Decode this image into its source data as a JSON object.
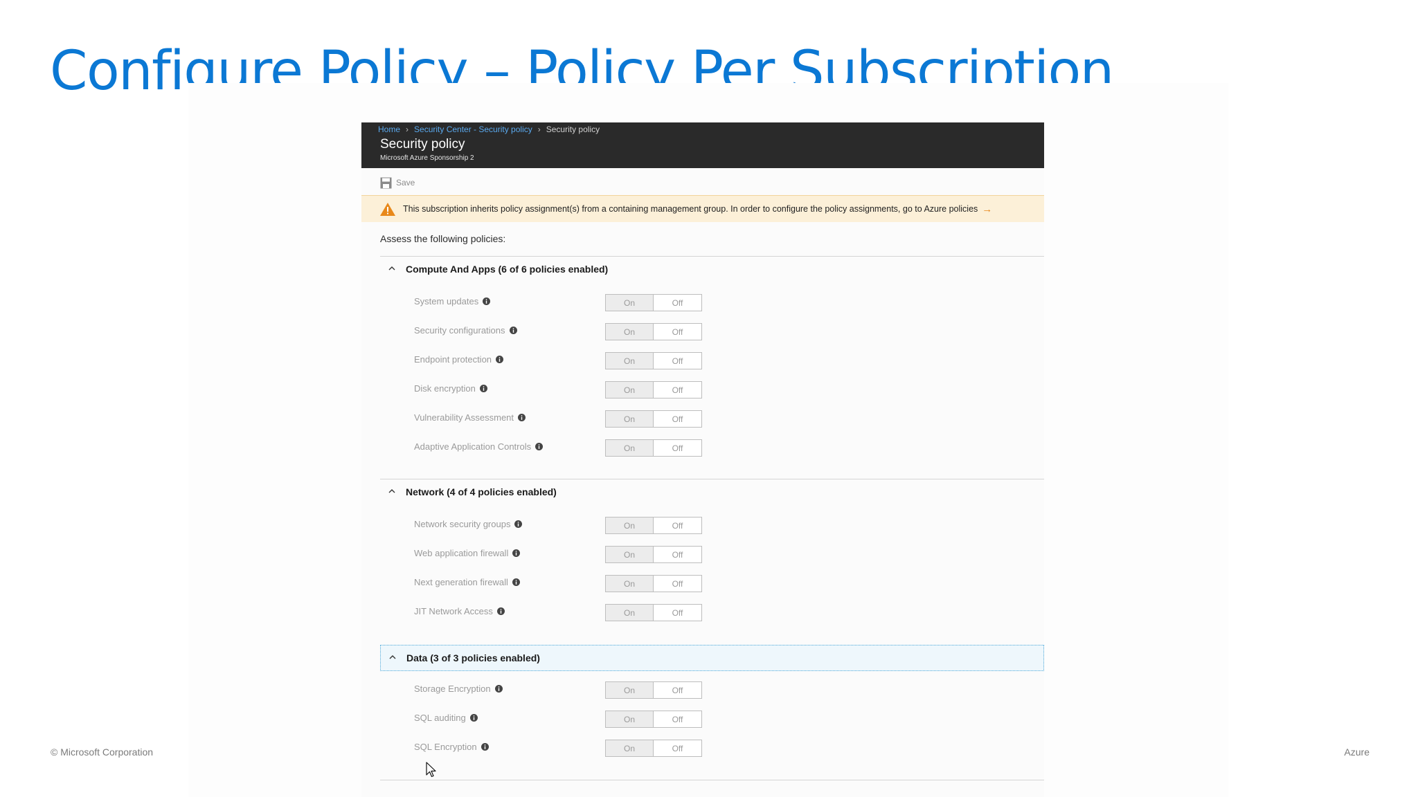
{
  "slide": {
    "title": "Configure Policy – Policy Per Subscription",
    "footer_left": "© Microsoft Corporation",
    "footer_right": "Azure"
  },
  "portal": {
    "breadcrumb": [
      "Home",
      "Security Center - Security policy",
      "Security policy"
    ],
    "blade_title": "Security policy",
    "blade_subtitle": "Microsoft Azure Sponsorship 2",
    "toolbar": {
      "save_label": "Save",
      "save_icon": "floppy-disk-icon"
    },
    "warning": {
      "icon": "warning-triangle-icon",
      "text": "This subscription inherits policy assignment(s) from a containing management group. In order to configure the policy assignments, go to Azure policies",
      "arrow": "→"
    },
    "assess_label": "Assess the following policies:",
    "sections": [
      {
        "title": "Compute And Apps (6 of 6 policies enabled)",
        "policies": [
          {
            "name": "System updates",
            "on": "On",
            "off": "Off"
          },
          {
            "name": "Security configurations",
            "on": "On",
            "off": "Off"
          },
          {
            "name": "Endpoint protection",
            "on": "On",
            "off": "Off"
          },
          {
            "name": "Disk encryption",
            "on": "On",
            "off": "Off"
          },
          {
            "name": "Vulnerability Assessment",
            "on": "On",
            "off": "Off"
          },
          {
            "name": "Adaptive Application Controls",
            "on": "On",
            "off": "Off"
          }
        ]
      },
      {
        "title": "Network (4 of 4 policies enabled)",
        "policies": [
          {
            "name": "Network security groups",
            "on": "On",
            "off": "Off"
          },
          {
            "name": "Web application firewall",
            "on": "On",
            "off": "Off"
          },
          {
            "name": "Next generation firewall",
            "on": "On",
            "off": "Off"
          },
          {
            "name": "JIT Network Access",
            "on": "On",
            "off": "Off"
          }
        ]
      },
      {
        "title": "Data (3 of 3 policies enabled)",
        "policies": [
          {
            "name": "Storage Encryption",
            "on": "On",
            "off": "Off"
          },
          {
            "name": "SQL auditing",
            "on": "On",
            "off": "Off"
          },
          {
            "name": "SQL Encryption",
            "on": "On",
            "off": "Off"
          }
        ]
      }
    ]
  },
  "colors": {
    "title_blue": "#0b78d4",
    "header_dark": "#2a2a2a",
    "link_blue": "#5aa9ee",
    "warning_bg": "#fcf0d8",
    "warning_orange": "#e8881a"
  }
}
